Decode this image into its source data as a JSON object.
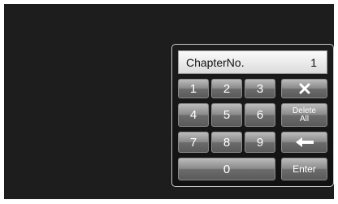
{
  "display": {
    "label": "ChapterNo.",
    "value": "1"
  },
  "keys": {
    "k1": "1",
    "k2": "2",
    "k3": "3",
    "k4": "4",
    "k5": "5",
    "k6": "6",
    "k7": "7",
    "k8": "8",
    "k9": "9",
    "k0": "0",
    "delete_all": "Delete\nAll",
    "enter": "Enter"
  },
  "icons": {
    "clear": "close-icon",
    "backspace": "arrow-left-icon"
  }
}
